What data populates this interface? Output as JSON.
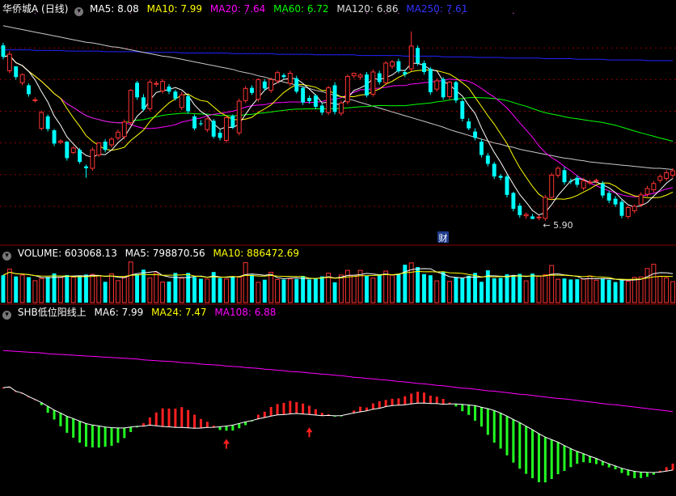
{
  "price_panel": {
    "title": "华侨城A (日线)",
    "legend": [
      {
        "label": "MA5: 8.08",
        "color": "#ffffff"
      },
      {
        "label": "MA10: 7.99",
        "color": "#ffff00"
      },
      {
        "label": "MA20: 7.64",
        "color": "#ff00ff"
      },
      {
        "label": "MA60: 6.72",
        "color": "#00ff00"
      },
      {
        "label": "MA120: 6.86",
        "color": "#dddddd"
      },
      {
        "label": "MA250: 7.61",
        "color": "#0000ff"
      }
    ],
    "low_marker": "5.90",
    "event_badge": "财"
  },
  "volume_panel": {
    "legend": [
      {
        "label": "VOLUME: 603068.13",
        "color": "#ffffff"
      },
      {
        "label": "MA5: 798870.56",
        "color": "#ffffff"
      },
      {
        "label": "MA10: 886472.69",
        "color": "#ffff00"
      }
    ]
  },
  "indicator_panel": {
    "legend": [
      {
        "label": "SHB低位阳线上",
        "color": "#ffffff"
      },
      {
        "label": "MA6: 7.99",
        "color": "#ffffff"
      },
      {
        "label": "MA24: 7.47",
        "color": "#ffff00"
      },
      {
        "label": "MA108: 6.88",
        "color": "#ff00ff"
      }
    ]
  },
  "colors": {
    "up": "#ff3333",
    "down": "#00ffff",
    "ma5": "#ffffff",
    "ma10": "#ffff00",
    "ma20": "#ff00ff",
    "ma60": "#00ff00",
    "ma120": "#c8c8c8",
    "ma250": "#2222ff",
    "grid": "#8b0000",
    "hist_up": "#ff2020",
    "hist_down": "#22ff22"
  },
  "chart_data": {
    "type": "candlestick",
    "close": [
      8.46,
      8.5,
      8.14,
      8.18,
      7.87,
      7.78,
      7.58,
      7.32,
      7.09,
      7.13,
      6.86,
      7.02,
      6.8,
      6.7,
      6.99,
      7.1,
      6.99,
      7.16,
      7.27,
      7.43,
      7.93,
      7.82,
      7.63,
      8.06,
      8.04,
      8.07,
      7.91,
      7.8,
      7.86,
      7.6,
      7.33,
      7.4,
      7.48,
      7.2,
      7.18,
      7.5,
      7.35,
      7.76,
      7.96,
      7.89,
      8.1,
      7.96,
      8.1,
      8.21,
      8.14,
      8.2,
      7.91,
      7.74,
      7.76,
      7.67,
      7.58,
      7.97,
      7.59,
      7.73,
      8.15,
      8.2,
      8.17,
      7.85,
      8.22,
      8.06,
      8.36,
      8.38,
      8.23,
      8.18,
      8.63,
      8.36,
      8.22,
      7.9,
      8.08,
      7.82,
      8.06,
      7.77,
      7.48,
      7.33,
      7.18,
      6.91,
      6.77,
      6.57,
      6.55,
      6.28,
      6.06,
      5.96,
      5.97,
      5.9,
      5.93,
      6.24,
      6.59,
      6.7,
      6.48,
      6.49,
      6.44,
      6.5,
      6.48,
      6.51,
      6.27,
      6.19,
      6.13,
      5.95,
      6.08,
      6.1,
      6.28,
      6.38,
      6.46,
      6.57,
      6.63,
      6.66
    ],
    "open": [
      8.64,
      8.24,
      8.31,
      8.05,
      8.01,
      7.78,
      7.33,
      7.52,
      7.3,
      7.11,
      7.12,
      6.95,
      6.99,
      6.73,
      6.7,
      6.91,
      7.12,
      7.07,
      7.18,
      7.2,
      7.42,
      8.05,
      7.82,
      7.64,
      8.03,
      7.92,
      7.99,
      7.91,
      7.66,
      7.84,
      7.52,
      7.41,
      7.31,
      7.45,
      7.26,
      7.14,
      7.53,
      7.26,
      7.77,
      7.97,
      7.79,
      8.07,
      7.93,
      8.08,
      8.17,
      8.04,
      8.12,
      7.97,
      7.81,
      7.85,
      7.69,
      7.58,
      8.01,
      7.57,
      7.75,
      8.16,
      8.14,
      8.18,
      7.87,
      8.2,
      8.05,
      8.31,
      8.39,
      8.22,
      8.27,
      8.6,
      8.36,
      8.27,
      7.95,
      8.11,
      7.83,
      8.06,
      7.76,
      7.44,
      7.28,
      7.12,
      6.9,
      6.77,
      6.58,
      6.57,
      6.31,
      6.11,
      5.95,
      5.94,
      5.92,
      5.91,
      6.24,
      6.59,
      6.67,
      6.5,
      6.55,
      6.39,
      6.47,
      6.51,
      6.46,
      6.31,
      6.22,
      6.17,
      5.94,
      6.03,
      6.13,
      6.29,
      6.36,
      6.51,
      6.54,
      6.59
    ],
    "high": [
      8.68,
      8.55,
      8.31,
      8.2,
      8.04,
      7.82,
      7.61,
      7.55,
      7.32,
      7.16,
      7.13,
      7.05,
      7.02,
      6.76,
      7.03,
      7.11,
      7.16,
      7.19,
      7.31,
      7.47,
      7.95,
      8.08,
      7.87,
      8.1,
      8.08,
      8.11,
      8.03,
      7.94,
      7.91,
      7.86,
      7.55,
      7.46,
      7.51,
      7.48,
      7.31,
      7.53,
      7.55,
      7.8,
      8.0,
      8.01,
      8.12,
      8.11,
      8.13,
      8.24,
      8.2,
      8.24,
      8.16,
      7.99,
      7.85,
      7.87,
      7.73,
      8.0,
      8.06,
      7.77,
      8.18,
      8.21,
      8.2,
      8.22,
      8.26,
      8.24,
      8.39,
      8.41,
      8.43,
      8.26,
      8.86,
      8.64,
      8.4,
      8.3,
      8.12,
      8.14,
      8.08,
      8.08,
      7.79,
      7.49,
      7.33,
      7.16,
      6.94,
      6.8,
      6.61,
      6.6,
      6.33,
      6.15,
      6.0,
      5.98,
      5.96,
      6.28,
      6.63,
      6.73,
      6.72,
      6.54,
      6.59,
      6.55,
      6.52,
      6.54,
      6.5,
      6.35,
      6.26,
      6.2,
      6.11,
      6.13,
      6.32,
      6.42,
      6.5,
      6.6,
      6.67,
      6.7
    ],
    "low": [
      8.42,
      8.2,
      8.1,
      8.01,
      7.83,
      7.74,
      7.3,
      7.28,
      7.05,
      7.08,
      6.82,
      6.92,
      6.77,
      6.55,
      6.66,
      6.88,
      6.95,
      7.03,
      7.14,
      7.16,
      7.38,
      7.78,
      7.6,
      7.6,
      7.99,
      7.88,
      7.87,
      7.77,
      7.62,
      7.56,
      7.3,
      7.37,
      7.27,
      7.17,
      7.14,
      7.1,
      7.32,
      7.22,
      7.73,
      7.86,
      7.75,
      7.92,
      7.89,
      8.04,
      8.1,
      8.0,
      7.88,
      7.7,
      7.72,
      7.63,
      7.54,
      7.54,
      7.55,
      7.53,
      7.71,
      8.12,
      8.1,
      7.82,
      7.83,
      8.02,
      8.01,
      8.27,
      8.2,
      8.14,
      8.23,
      8.32,
      8.18,
      7.86,
      7.91,
      7.78,
      7.79,
      7.73,
      7.44,
      7.3,
      7.14,
      6.87,
      6.73,
      6.53,
      6.51,
      6.24,
      6.02,
      5.92,
      5.9,
      5.9,
      5.88,
      5.87,
      6.2,
      6.55,
      6.44,
      6.45,
      6.4,
      6.35,
      6.44,
      6.46,
      6.23,
      6.15,
      6.09,
      5.91,
      5.9,
      5.99,
      6.09,
      6.25,
      6.32,
      6.47,
      6.5,
      6.55
    ],
    "volume": [
      1.17,
      1.43,
      1.12,
      1.18,
      1.09,
      0.94,
      1.03,
      1.1,
      1.25,
      1.08,
      1.18,
      1.09,
      1.15,
      1.2,
      1.21,
      1.16,
      0.89,
      1.23,
      0.94,
      1.09,
      1.74,
      1.21,
      1.41,
      1.05,
      1.27,
      0.88,
      0.9,
      1.27,
      1.05,
      1.27,
      1.09,
      1.02,
      1.01,
      1.31,
      1.05,
      1.01,
      1.12,
      1.09,
      1.71,
      1.19,
      0.87,
      0.98,
      1.3,
      0.99,
      0.99,
      1.01,
      1.01,
      1.14,
      0.99,
      1.03,
      1.12,
      1.26,
      0.87,
      1.18,
      1.38,
      1.17,
      1.38,
      1.14,
      1.05,
      1.21,
      1.35,
      1.18,
      1.21,
      1.62,
      1.7,
      1.52,
      1.22,
      1.17,
      0.93,
      1.31,
      0.91,
      1.09,
      1.04,
      1.15,
      1.27,
      0.89,
      1.38,
      1.04,
      1.06,
      1.21,
      1.16,
      1.23,
      0.93,
      1.24,
      1.13,
      1.19,
      1.59,
      1.0,
      1.03,
      0.99,
      1.0,
      1.01,
      1.14,
      0.96,
      1.04,
      0.98,
      0.88,
      0.99,
      0.92,
      1.08,
      1.1,
      1.46,
      1.64,
      1.13,
      1.06,
      0.9
    ],
    "ma120": [
      8.95,
      8.93,
      8.91,
      8.89,
      8.87,
      8.85,
      8.83,
      8.81,
      8.79,
      8.77,
      8.75,
      8.73,
      8.71,
      8.69,
      8.68,
      8.66,
      8.64,
      8.62,
      8.61,
      8.59,
      8.57,
      8.55,
      8.53,
      8.51,
      8.49,
      8.47,
      8.46,
      8.44,
      8.42,
      8.4,
      8.38,
      8.36,
      8.34,
      8.32,
      8.3,
      8.28,
      8.26,
      8.23,
      8.21,
      8.19,
      8.16,
      8.14,
      8.11,
      8.09,
      8.06,
      8.04,
      8.01,
      7.99,
      7.96,
      7.93,
      7.91,
      7.88,
      7.85,
      7.83,
      7.8,
      7.77,
      7.74,
      7.71,
      7.68,
      7.65,
      7.62,
      7.59,
      7.56,
      7.53,
      7.5,
      7.47,
      7.44,
      7.41,
      7.38,
      7.35,
      7.31,
      7.28,
      7.25,
      7.22,
      7.19,
      7.16,
      7.13,
      7.1,
      7.08,
      7.05,
      7.03,
      7.0,
      6.98,
      6.96,
      6.94,
      6.92,
      6.9,
      6.88,
      6.86,
      6.85,
      6.83,
      6.82,
      6.8,
      6.79,
      6.78,
      6.77,
      6.76,
      6.75,
      6.74,
      6.73,
      6.72,
      6.71,
      6.7,
      6.7,
      6.69,
      6.68
    ],
    "ma250": [
      8.57,
      8.57,
      8.57,
      8.57,
      8.57,
      8.56,
      8.56,
      8.56,
      8.56,
      8.56,
      8.55,
      8.55,
      8.55,
      8.55,
      8.55,
      8.55,
      8.54,
      8.54,
      8.54,
      8.54,
      8.54,
      8.54,
      8.53,
      8.53,
      8.53,
      8.53,
      8.53,
      8.53,
      8.52,
      8.52,
      8.52,
      8.52,
      8.52,
      8.52,
      8.52,
      8.52,
      8.51,
      8.51,
      8.51,
      8.51,
      8.51,
      8.51,
      8.51,
      8.5,
      8.5,
      8.5,
      8.5,
      8.5,
      8.5,
      8.49,
      8.49,
      8.49,
      8.49,
      8.49,
      8.49,
      8.49,
      8.48,
      8.48,
      8.48,
      8.48,
      8.48,
      8.48,
      8.48,
      8.47,
      8.47,
      8.47,
      8.47,
      8.47,
      8.47,
      8.46,
      8.46,
      8.46,
      8.46,
      8.46,
      8.45,
      8.45,
      8.45,
      8.45,
      8.45,
      8.44,
      8.44,
      8.44,
      8.44,
      8.44,
      8.44,
      8.43,
      8.43,
      8.43,
      8.43,
      8.43,
      8.42,
      8.42,
      8.42,
      8.42,
      8.42,
      8.41,
      8.41,
      8.41,
      8.41,
      8.41,
      8.41,
      8.4,
      8.4,
      8.4,
      8.4,
      8.4
    ],
    "indicator_ma108": [
      9.42,
      9.41,
      9.4,
      9.39,
      9.38,
      9.37,
      9.36,
      9.34,
      9.33,
      9.32,
      9.31,
      9.3,
      9.29,
      9.28,
      9.27,
      9.26,
      9.25,
      9.24,
      9.23,
      9.22,
      9.21,
      9.2,
      9.18,
      9.17,
      9.16,
      9.15,
      9.14,
      9.13,
      9.11,
      9.1,
      9.09,
      9.07,
      9.06,
      9.05,
      9.04,
      9.02,
      9.01,
      9.0,
      8.98,
      8.97,
      8.96,
      8.94,
      8.93,
      8.91,
      8.9,
      8.88,
      8.87,
      8.86,
      8.84,
      8.83,
      8.81,
      8.8,
      8.78,
      8.77,
      8.75,
      8.73,
      8.72,
      8.7,
      8.69,
      8.67,
      8.66,
      8.64,
      8.62,
      8.61,
      8.59,
      8.57,
      8.56,
      8.54,
      8.52,
      8.51,
      8.49,
      8.47,
      8.45,
      8.44,
      8.42,
      8.4,
      8.38,
      8.37,
      8.35,
      8.33,
      8.31,
      8.29,
      8.28,
      8.26,
      8.24,
      8.22,
      8.2,
      8.18,
      8.17,
      8.15,
      8.13,
      8.11,
      8.09,
      8.07,
      8.05,
      8.03,
      8.02,
      8.0,
      7.98,
      7.96,
      7.94,
      7.92,
      7.9,
      7.88,
      7.86,
      7.84
    ],
    "signal_arrows_at": [
      35,
      48
    ],
    "low_marker_at": 84
  }
}
